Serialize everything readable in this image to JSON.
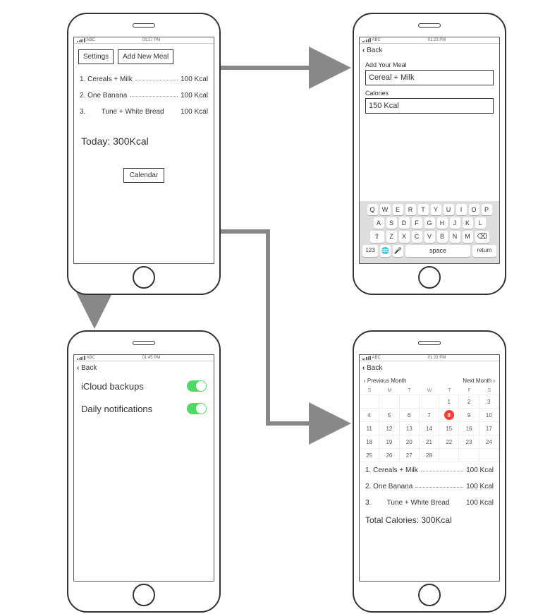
{
  "statusbar": {
    "carrier": "ABC",
    "time1": "03:27 PM",
    "time2": "01:23 PM",
    "time3": "01:45 PM",
    "time4": "01:23 PM"
  },
  "home_screen": {
    "settings_btn": "Settings",
    "add_meal_btn": "Add New Meal",
    "meals": [
      {
        "idx": "1.",
        "name": "Cereals + Milk",
        "kcal": "100 Kcal"
      },
      {
        "idx": "2.",
        "name": "One Banana",
        "kcal": "100 Kcal"
      },
      {
        "idx": "3.",
        "name": "Tune + White Bread",
        "kcal": "100 Kcal"
      }
    ],
    "today_total": "Today: 300Kcal",
    "calendar_btn": "Calendar"
  },
  "add_meal_screen": {
    "back": "Back",
    "meal_label": "Add Your Meal",
    "meal_value": "Cereal + Milk",
    "cal_label": "Calories",
    "cal_value": "150 Kcal",
    "keyboard": {
      "row1": [
        "Q",
        "W",
        "E",
        "R",
        "T",
        "Y",
        "U",
        "I",
        "O",
        "P"
      ],
      "row2": [
        "A",
        "S",
        "D",
        "F",
        "G",
        "H",
        "J",
        "K",
        "L"
      ],
      "row3_shift": "⇧",
      "row3": [
        "Z",
        "X",
        "C",
        "V",
        "B",
        "N",
        "M"
      ],
      "row3_back": "⌫",
      "row4_num": "123",
      "row4_globe": "🌐",
      "row4_mic": "🎤",
      "row4_space": "space",
      "row4_return": "return"
    }
  },
  "settings_screen": {
    "back": "Back",
    "rows": [
      {
        "label": "iCloud backups",
        "on": true
      },
      {
        "label": "Daily notifications",
        "on": true
      }
    ]
  },
  "calendar_screen": {
    "back": "Back",
    "prev": "‹ Previous Month",
    "next": "Next Month ›",
    "weekdays": [
      "S",
      "M",
      "T",
      "W",
      "T",
      "F",
      "S"
    ],
    "days": [
      "",
      "",
      "",
      "",
      "1",
      "2",
      "3",
      "4",
      "5",
      "6",
      "7",
      "8",
      "9",
      "10",
      "11",
      "12",
      "13",
      "14",
      "15",
      "16",
      "17",
      "18",
      "19",
      "20",
      "21",
      "22",
      "23",
      "24",
      "25",
      "26",
      "27",
      "28",
      "",
      "",
      ""
    ],
    "selected_day": "8",
    "meals": [
      {
        "idx": "1.",
        "name": "Cereals + Milk",
        "kcal": "100 Kcal"
      },
      {
        "idx": "2.",
        "name": "One Banana",
        "kcal": "100 Kcal"
      },
      {
        "idx": "3.",
        "name": "Tune + White Bread",
        "kcal": "100 Kcal"
      }
    ],
    "total": "Total Calories: 300Kcal"
  }
}
